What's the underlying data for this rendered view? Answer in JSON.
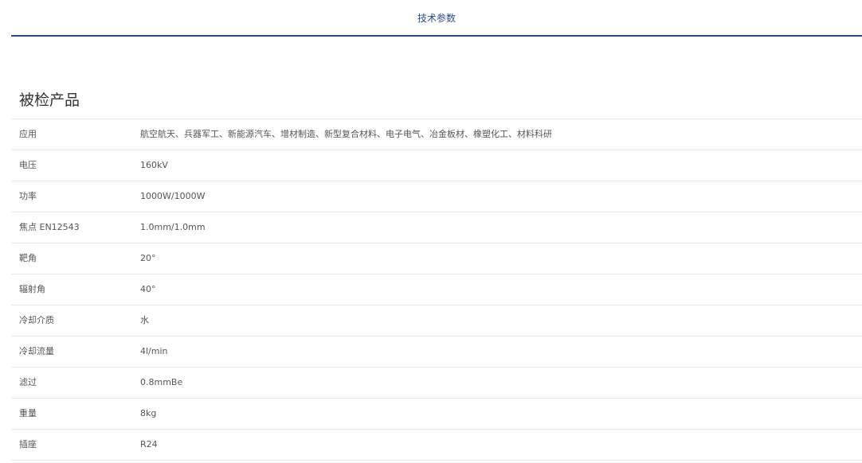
{
  "tabs": [
    {
      "label": "技术参数",
      "active": true
    }
  ],
  "section": {
    "title": "被检产品"
  },
  "specs": [
    {
      "label": "应用",
      "value": "航空航天、兵器军工、新能源汽车、增材制造、新型复合材料、电子电气、冶金板材、橡塑化工、材料科研"
    },
    {
      "label": "电压",
      "value": "160kV"
    },
    {
      "label": "功率",
      "value": "1000W/1000W"
    },
    {
      "label": "焦点 EN12543",
      "value": "1.0mm/1.0mm"
    },
    {
      "label": "靶角",
      "value": "20°"
    },
    {
      "label": "辐射角",
      "value": "40°"
    },
    {
      "label": "冷却介质",
      "value": "水"
    },
    {
      "label": "冷却流量",
      "value": "4l/min"
    },
    {
      "label": "滤过",
      "value": "0.8mmBe"
    },
    {
      "label": "重量",
      "value": "8kg"
    },
    {
      "label": "插座",
      "value": "R24"
    }
  ],
  "colors": {
    "accent": "#2a4a8c",
    "divider": "#e8e8e8",
    "text": "#555555"
  }
}
